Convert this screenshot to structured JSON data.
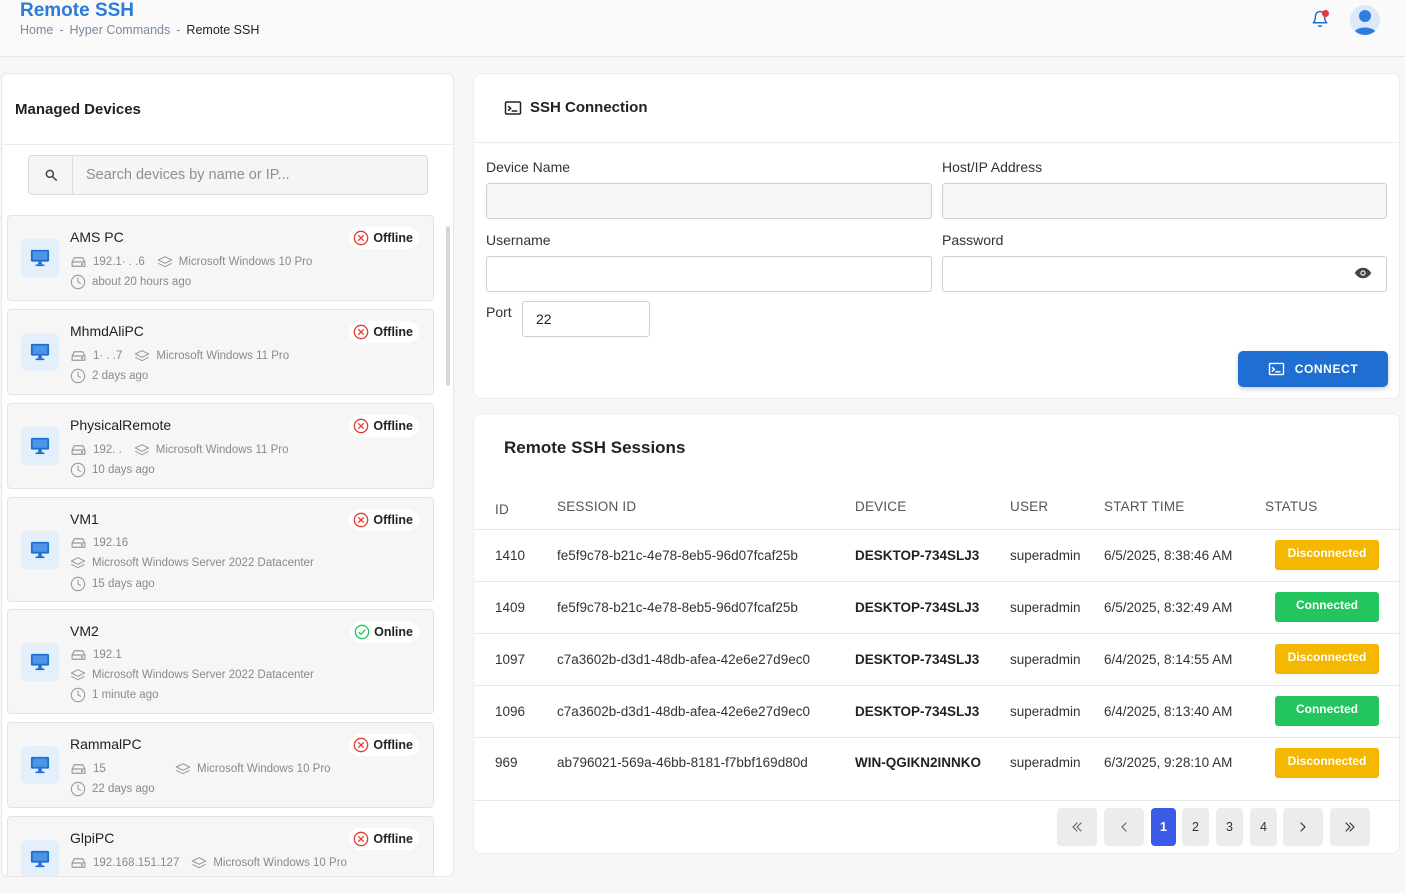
{
  "header": {
    "title": "Remote SSH",
    "breadcrumb": [
      "Home",
      "Hyper Commands",
      "Remote SSH"
    ],
    "breadcrumb_sep": "-"
  },
  "devices_panel": {
    "title": "Managed Devices",
    "search_placeholder": "Search devices by name or IP...",
    "devices": [
      {
        "name": "AMS PC",
        "status": "Offline",
        "ip": "192.1· .   .6",
        "os": "Microsoft Windows 10 Pro",
        "last_seen": "about 20 hours ago"
      },
      {
        "name": "MhmdAliPC",
        "status": "Offline",
        "ip": "1· .   .7",
        "os": "Microsoft Windows 11 Pro",
        "last_seen": "2 days ago"
      },
      {
        "name": "PhysicalRemote",
        "status": "Offline",
        "ip": "192.   .   ",
        "os": "Microsoft Windows 11 Pro",
        "last_seen": "10 days ago"
      },
      {
        "name": "VM1",
        "status": "Offline",
        "ip": "192.16",
        "os": "Microsoft Windows Server 2022 Datacenter",
        "last_seen": "15 days ago"
      },
      {
        "name": "VM2",
        "status": "Online",
        "ip": "192.1",
        "os": "Microsoft Windows Server 2022 Datacenter",
        "last_seen": "1 minute ago"
      },
      {
        "name": "RammalPC",
        "status": "Offline",
        "ip": "15",
        "os": "Microsoft Windows 10 Pro",
        "last_seen": "22 days ago"
      },
      {
        "name": "GlpiPC",
        "status": "Offline",
        "ip": "192.168.151.127",
        "os": "Microsoft Windows 10 Pro",
        "last_seen": ""
      }
    ]
  },
  "ssh_form": {
    "title": "SSH Connection",
    "device_name_label": "Device Name",
    "device_name_value": "",
    "host_label": "Host/IP Address",
    "host_value": "",
    "username_label": "Username",
    "username_value": "",
    "password_label": "Password",
    "password_value": "",
    "port_label": "Port",
    "port_value": "22",
    "connect_label": "CONNECT"
  },
  "sessions": {
    "title": "Remote SSH Sessions",
    "columns": [
      "ID",
      "SESSION ID",
      "DEVICE",
      "USER",
      "START TIME",
      "STATUS"
    ],
    "rows": [
      {
        "id": "1410",
        "session_id": "fe5f9c78-b21c-4e78-8eb5-96d07fcaf25b",
        "device": "DESKTOP-734SLJ3",
        "user": "superadmin",
        "start_time": "6/5/2025, 8:38:46 AM",
        "status": "Disconnected"
      },
      {
        "id": "1409",
        "session_id": "fe5f9c78-b21c-4e78-8eb5-96d07fcaf25b",
        "device": "DESKTOP-734SLJ3",
        "user": "superadmin",
        "start_time": "6/5/2025, 8:32:49 AM",
        "status": "Connected"
      },
      {
        "id": "1097",
        "session_id": "c7a3602b-d3d1-48db-afea-42e6e27d9ec0",
        "device": "DESKTOP-734SLJ3",
        "user": "superadmin",
        "start_time": "6/4/2025, 8:14:55 AM",
        "status": "Disconnected"
      },
      {
        "id": "1096",
        "session_id": "c7a3602b-d3d1-48db-afea-42e6e27d9ec0",
        "device": "DESKTOP-734SLJ3",
        "user": "superadmin",
        "start_time": "6/4/2025, 8:13:40 AM",
        "status": "Connected"
      },
      {
        "id": "969",
        "session_id": "ab796021-569a-46bb-8181-f7bbf169d80d",
        "device": "WIN-QGIKN2INNKO",
        "user": "superadmin",
        "start_time": "6/3/2025, 9:28:10 AM",
        "status": "Disconnected"
      }
    ],
    "pagination": {
      "pages": [
        "1",
        "2",
        "3",
        "4"
      ],
      "current": "1",
      "first_icon": "double-chevron-left-icon",
      "prev_icon": "chevron-left-icon",
      "next_icon": "chevron-right-icon",
      "last_icon": "double-chevron-right-icon"
    }
  },
  "colors": {
    "brand": "#2b7bd9",
    "connect_button": "#1f6fd2",
    "disconnected": "#f5b800",
    "connected": "#22c55e",
    "offline": "#e53935",
    "online": "#22c55e",
    "active_page": "#3b5be6"
  }
}
